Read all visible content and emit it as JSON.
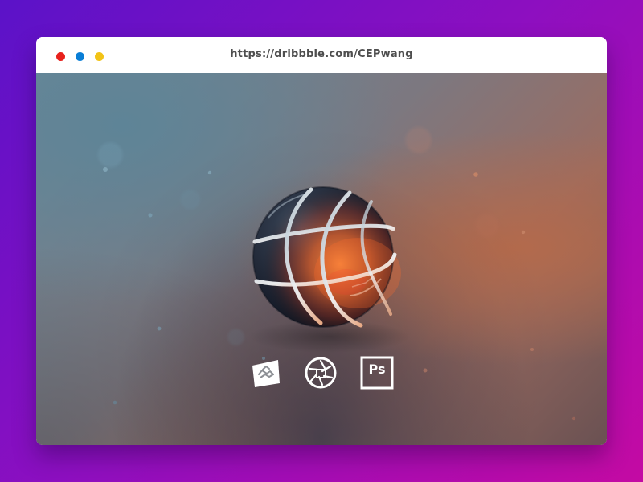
{
  "browser": {
    "url": "https://dribbble.com/CEPwang",
    "traffic_lights": [
      {
        "name": "close",
        "color": "#e8211c"
      },
      {
        "name": "minimize",
        "color": "#0a7ed6"
      },
      {
        "name": "zoom",
        "color": "#f2c316"
      }
    ]
  },
  "scene": {
    "object": "basketball",
    "colors": {
      "ball_dark": "#232938",
      "ball_orange": "#d35d2b",
      "seam": "#d8dce2",
      "floor_blue": "#6b8898",
      "floor_orange": "#b36a4c"
    }
  },
  "tools": [
    {
      "name": "keyshot",
      "icon": "keyshot-icon"
    },
    {
      "name": "aperture",
      "icon": "aperture-icon"
    },
    {
      "name": "photoshop",
      "icon": "photoshop-icon",
      "label": "Ps"
    }
  ]
}
